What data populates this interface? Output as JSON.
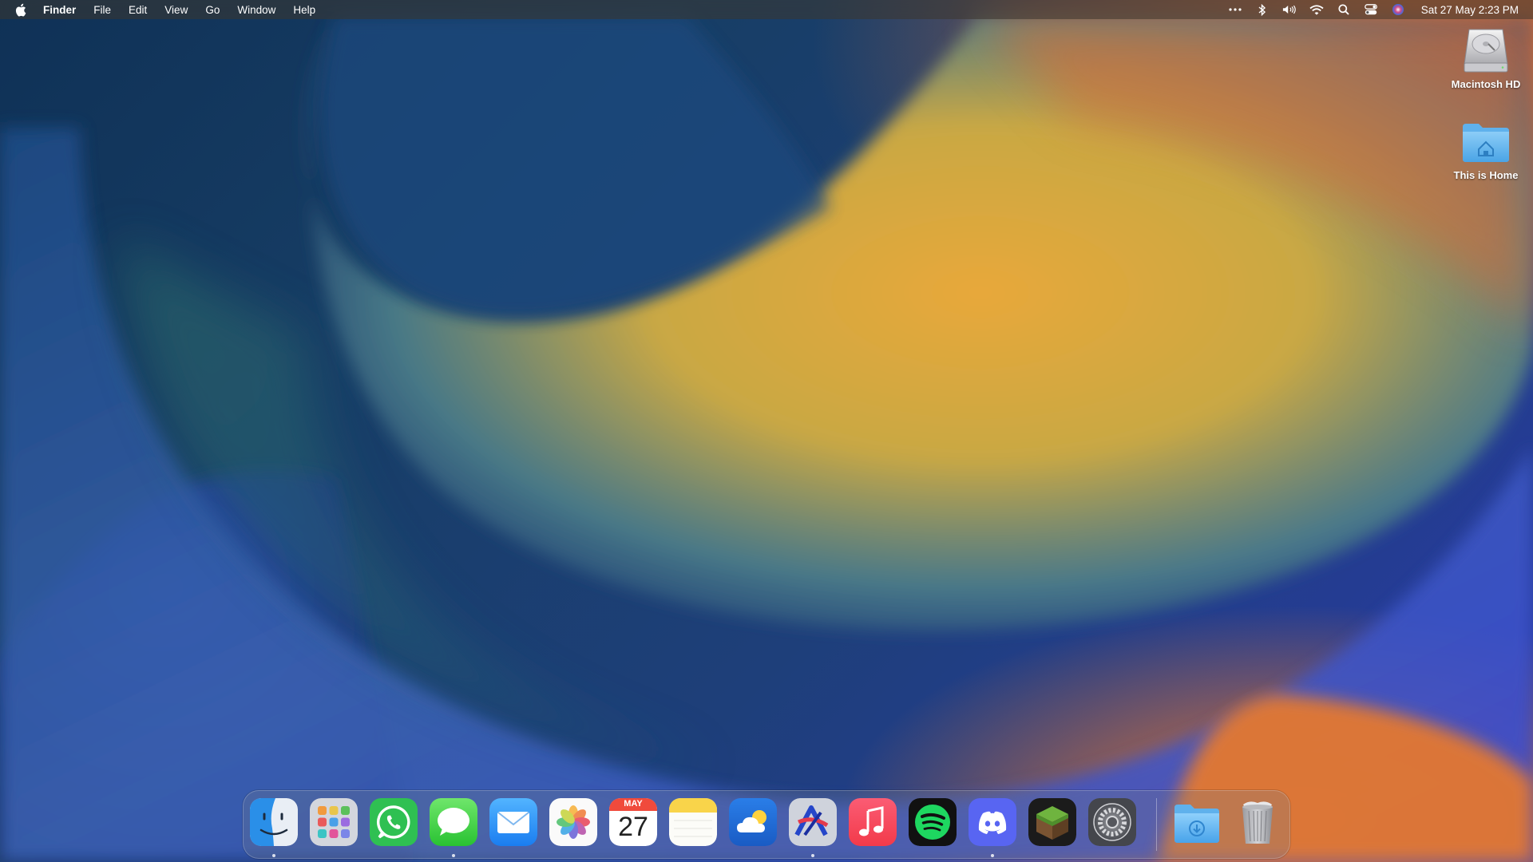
{
  "menubar": {
    "app_name": "Finder",
    "menus": [
      "File",
      "Edit",
      "View",
      "Go",
      "Window",
      "Help"
    ],
    "status_icons": [
      "more-icon",
      "bluetooth-icon",
      "volume-icon",
      "wifi-icon",
      "search-icon",
      "control-center-icon",
      "siri-icon"
    ],
    "clock": "Sat 27 May  2:23 PM"
  },
  "desktop": {
    "icons": [
      {
        "label": "Macintosh HD",
        "icon": "hard-drive-icon"
      },
      {
        "label": "This is Home",
        "icon": "home-folder-icon"
      }
    ]
  },
  "dock": {
    "apps": [
      {
        "name": "Finder",
        "icon": "finder-icon",
        "running": true
      },
      {
        "name": "Launchpad",
        "icon": "launchpad-icon",
        "running": false
      },
      {
        "name": "WhatsApp",
        "icon": "whatsapp-icon",
        "running": false
      },
      {
        "name": "Messages",
        "icon": "messages-icon",
        "running": true
      },
      {
        "name": "Mail",
        "icon": "mail-icon",
        "running": false
      },
      {
        "name": "Photos",
        "icon": "photos-icon",
        "running": false
      },
      {
        "name": "Calendar",
        "icon": "calendar-icon",
        "running": false
      },
      {
        "name": "Notes",
        "icon": "notes-icon",
        "running": false
      },
      {
        "name": "Weather",
        "icon": "weather-icon",
        "running": false
      },
      {
        "name": "Affinity",
        "icon": "affinity-icon",
        "running": true
      },
      {
        "name": "Music",
        "icon": "music-icon",
        "running": false
      },
      {
        "name": "Spotify",
        "icon": "spotify-icon",
        "running": false
      },
      {
        "name": "Discord",
        "icon": "discord-icon",
        "running": true
      },
      {
        "name": "Minecraft",
        "icon": "minecraft-icon",
        "running": false
      },
      {
        "name": "System Settings",
        "icon": "settings-gear-icon",
        "running": false
      },
      {
        "name": "Downloads",
        "icon": "downloads-folder-icon",
        "running": false
      },
      {
        "name": "Trash",
        "icon": "trash-icon",
        "running": false
      }
    ],
    "calendar_month": "MAY",
    "calendar_day": "27"
  }
}
